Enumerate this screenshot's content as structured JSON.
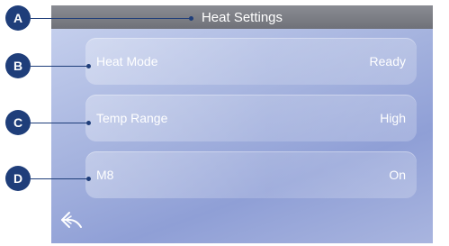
{
  "header": {
    "title": "Heat Settings"
  },
  "settings": [
    {
      "label": "Heat Mode",
      "value": "Ready"
    },
    {
      "label": "Temp Range",
      "value": "High"
    },
    {
      "label": "M8",
      "value": "On"
    }
  ],
  "callouts": [
    "A",
    "B",
    "C",
    "D"
  ],
  "icons": {
    "back": "back-arrow-icon"
  },
  "colors": {
    "callout": "#1f3e7a",
    "titlebar": "#7c7e86",
    "screen_bg": "#a4b2de"
  }
}
